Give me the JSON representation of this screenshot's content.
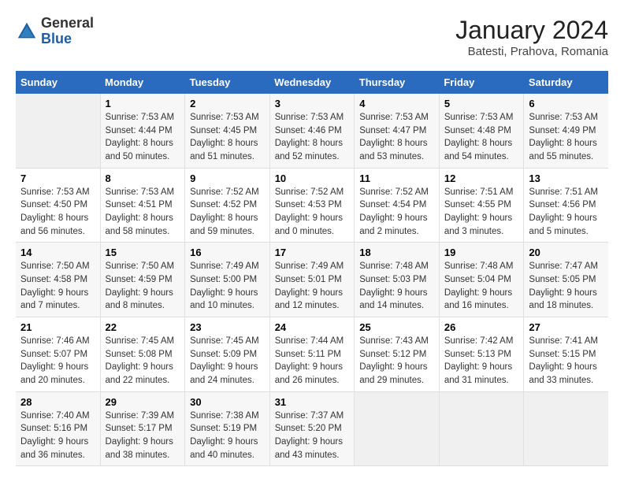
{
  "header": {
    "logo_line1": "General",
    "logo_line2": "Blue",
    "title": "January 2024",
    "subtitle": "Batesti, Prahova, Romania"
  },
  "weekdays": [
    "Sunday",
    "Monday",
    "Tuesday",
    "Wednesday",
    "Thursday",
    "Friday",
    "Saturday"
  ],
  "weeks": [
    [
      {
        "day": "",
        "info": ""
      },
      {
        "day": "1",
        "info": "Sunrise: 7:53 AM\nSunset: 4:44 PM\nDaylight: 8 hours\nand 50 minutes."
      },
      {
        "day": "2",
        "info": "Sunrise: 7:53 AM\nSunset: 4:45 PM\nDaylight: 8 hours\nand 51 minutes."
      },
      {
        "day": "3",
        "info": "Sunrise: 7:53 AM\nSunset: 4:46 PM\nDaylight: 8 hours\nand 52 minutes."
      },
      {
        "day": "4",
        "info": "Sunrise: 7:53 AM\nSunset: 4:47 PM\nDaylight: 8 hours\nand 53 minutes."
      },
      {
        "day": "5",
        "info": "Sunrise: 7:53 AM\nSunset: 4:48 PM\nDaylight: 8 hours\nand 54 minutes."
      },
      {
        "day": "6",
        "info": "Sunrise: 7:53 AM\nSunset: 4:49 PM\nDaylight: 8 hours\nand 55 minutes."
      }
    ],
    [
      {
        "day": "7",
        "info": "Sunrise: 7:53 AM\nSunset: 4:50 PM\nDaylight: 8 hours\nand 56 minutes."
      },
      {
        "day": "8",
        "info": "Sunrise: 7:53 AM\nSunset: 4:51 PM\nDaylight: 8 hours\nand 58 minutes."
      },
      {
        "day": "9",
        "info": "Sunrise: 7:52 AM\nSunset: 4:52 PM\nDaylight: 8 hours\nand 59 minutes."
      },
      {
        "day": "10",
        "info": "Sunrise: 7:52 AM\nSunset: 4:53 PM\nDaylight: 9 hours\nand 0 minutes."
      },
      {
        "day": "11",
        "info": "Sunrise: 7:52 AM\nSunset: 4:54 PM\nDaylight: 9 hours\nand 2 minutes."
      },
      {
        "day": "12",
        "info": "Sunrise: 7:51 AM\nSunset: 4:55 PM\nDaylight: 9 hours\nand 3 minutes."
      },
      {
        "day": "13",
        "info": "Sunrise: 7:51 AM\nSunset: 4:56 PM\nDaylight: 9 hours\nand 5 minutes."
      }
    ],
    [
      {
        "day": "14",
        "info": "Sunrise: 7:50 AM\nSunset: 4:58 PM\nDaylight: 9 hours\nand 7 minutes."
      },
      {
        "day": "15",
        "info": "Sunrise: 7:50 AM\nSunset: 4:59 PM\nDaylight: 9 hours\nand 8 minutes."
      },
      {
        "day": "16",
        "info": "Sunrise: 7:49 AM\nSunset: 5:00 PM\nDaylight: 9 hours\nand 10 minutes."
      },
      {
        "day": "17",
        "info": "Sunrise: 7:49 AM\nSunset: 5:01 PM\nDaylight: 9 hours\nand 12 minutes."
      },
      {
        "day": "18",
        "info": "Sunrise: 7:48 AM\nSunset: 5:03 PM\nDaylight: 9 hours\nand 14 minutes."
      },
      {
        "day": "19",
        "info": "Sunrise: 7:48 AM\nSunset: 5:04 PM\nDaylight: 9 hours\nand 16 minutes."
      },
      {
        "day": "20",
        "info": "Sunrise: 7:47 AM\nSunset: 5:05 PM\nDaylight: 9 hours\nand 18 minutes."
      }
    ],
    [
      {
        "day": "21",
        "info": "Sunrise: 7:46 AM\nSunset: 5:07 PM\nDaylight: 9 hours\nand 20 minutes."
      },
      {
        "day": "22",
        "info": "Sunrise: 7:45 AM\nSunset: 5:08 PM\nDaylight: 9 hours\nand 22 minutes."
      },
      {
        "day": "23",
        "info": "Sunrise: 7:45 AM\nSunset: 5:09 PM\nDaylight: 9 hours\nand 24 minutes."
      },
      {
        "day": "24",
        "info": "Sunrise: 7:44 AM\nSunset: 5:11 PM\nDaylight: 9 hours\nand 26 minutes."
      },
      {
        "day": "25",
        "info": "Sunrise: 7:43 AM\nSunset: 5:12 PM\nDaylight: 9 hours\nand 29 minutes."
      },
      {
        "day": "26",
        "info": "Sunrise: 7:42 AM\nSunset: 5:13 PM\nDaylight: 9 hours\nand 31 minutes."
      },
      {
        "day": "27",
        "info": "Sunrise: 7:41 AM\nSunset: 5:15 PM\nDaylight: 9 hours\nand 33 minutes."
      }
    ],
    [
      {
        "day": "28",
        "info": "Sunrise: 7:40 AM\nSunset: 5:16 PM\nDaylight: 9 hours\nand 36 minutes."
      },
      {
        "day": "29",
        "info": "Sunrise: 7:39 AM\nSunset: 5:17 PM\nDaylight: 9 hours\nand 38 minutes."
      },
      {
        "day": "30",
        "info": "Sunrise: 7:38 AM\nSunset: 5:19 PM\nDaylight: 9 hours\nand 40 minutes."
      },
      {
        "day": "31",
        "info": "Sunrise: 7:37 AM\nSunset: 5:20 PM\nDaylight: 9 hours\nand 43 minutes."
      },
      {
        "day": "",
        "info": ""
      },
      {
        "day": "",
        "info": ""
      },
      {
        "day": "",
        "info": ""
      }
    ]
  ]
}
